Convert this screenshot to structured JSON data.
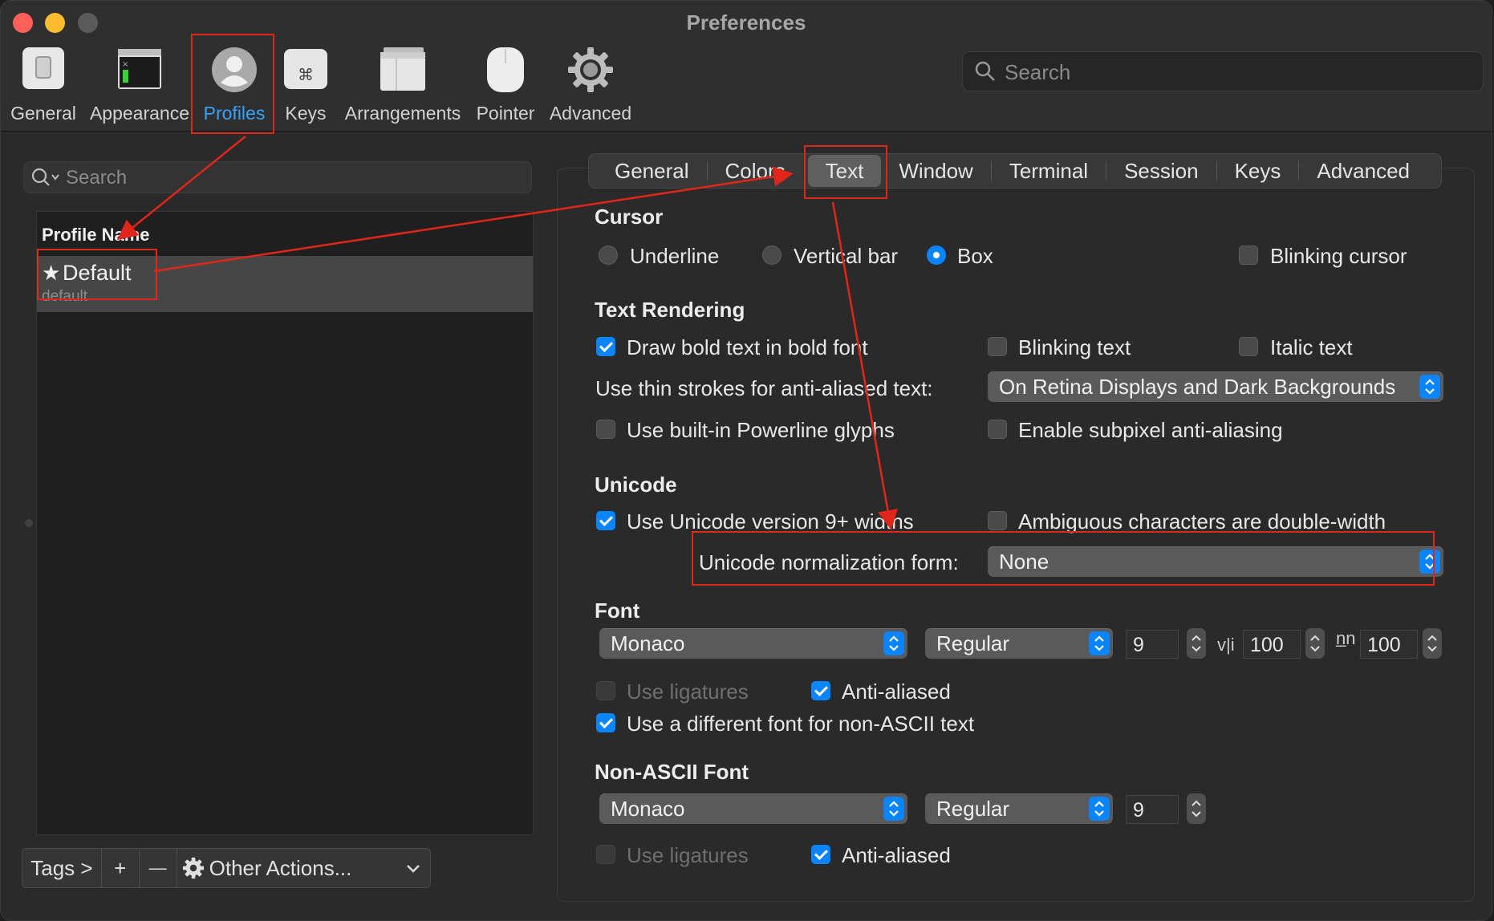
{
  "window": {
    "title": "Preferences"
  },
  "toolbar": {
    "items": [
      {
        "label": "General",
        "icon": "general-switch-icon"
      },
      {
        "label": "Appearance",
        "icon": "appearance-window-icon"
      },
      {
        "label": "Profiles",
        "icon": "profile-person-icon",
        "selected": true
      },
      {
        "label": "Keys",
        "icon": "command-key-icon"
      },
      {
        "label": "Arrangements",
        "icon": "arrangements-window-icon"
      },
      {
        "label": "Pointer",
        "icon": "mouse-pointer-icon"
      },
      {
        "label": "Advanced",
        "icon": "gear-icon"
      }
    ],
    "search_placeholder": "Search"
  },
  "sidebar": {
    "search_placeholder": "Search",
    "column_header": "Profile Name",
    "profiles": [
      {
        "name": "Default",
        "subtitle": "default",
        "starred": true
      }
    ],
    "bottom": {
      "tags": "Tags >",
      "add": "+",
      "remove": "—",
      "other": "Other Actions..."
    }
  },
  "tabs": [
    "General",
    "Colors",
    "Text",
    "Window",
    "Terminal",
    "Session",
    "Keys",
    "Advanced"
  ],
  "active_tab": "Text",
  "cursor": {
    "heading": "Cursor",
    "options": [
      "Underline",
      "Vertical bar",
      "Box"
    ],
    "selected": "Box",
    "blinking_label": "Blinking cursor",
    "blinking": false
  },
  "text_rendering": {
    "heading": "Text Rendering",
    "bold_label": "Draw bold text in bold font",
    "blinking_text_label": "Blinking text",
    "italic_label": "Italic text",
    "thin_strokes_label": "Use thin strokes for anti-aliased text:",
    "thin_strokes_value": "On Retina Displays and Dark Backgrounds",
    "powerline_label": "Use built-in Powerline glyphs",
    "subpixel_label": "Enable subpixel anti-aliasing"
  },
  "unicode": {
    "heading": "Unicode",
    "widths_label": "Use Unicode version 9+ widths",
    "ambiguous_label": "Ambiguous characters are double-width",
    "normalization_label": "Unicode normalization form:",
    "normalization_value": "None"
  },
  "font": {
    "heading": "Font",
    "family": "Monaco",
    "style": "Regular",
    "size": "9",
    "vspacing_glyph": "v|i",
    "vspacing": "100",
    "hspacing_glyph": "n̲n",
    "hspacing": "100",
    "ligatures_label": "Use ligatures",
    "antialiased_label": "Anti-aliased",
    "non_ascii_label": "Use a different font for non-ASCII text"
  },
  "non_ascii_font": {
    "heading": "Non-ASCII Font",
    "family": "Monaco",
    "style": "Regular",
    "size": "9",
    "ligatures_label": "Use ligatures",
    "antialiased_label": "Anti-aliased"
  },
  "colors": {
    "accent": "#0a84ff",
    "selected_toolbar": "#35a3ff",
    "annotation": "#e0261b"
  }
}
